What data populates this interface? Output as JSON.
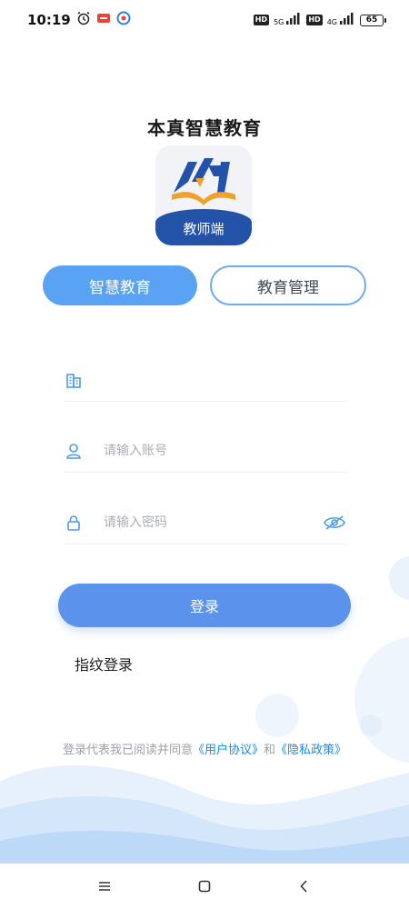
{
  "status_bar": {
    "time": "10:19",
    "net_1": "5G",
    "net_2": "4G",
    "hd": "HD",
    "battery": "65"
  },
  "app": {
    "title": "本真智慧教育",
    "logo_band_text": "教师端"
  },
  "tabs": [
    {
      "label": "智慧教育",
      "active": true
    },
    {
      "label": "教育管理",
      "active": false
    }
  ],
  "form": {
    "school_field": {
      "value": "",
      "placeholder": ""
    },
    "account_field": {
      "value": "",
      "placeholder": "请输入账号"
    },
    "password_field": {
      "value": "",
      "placeholder": "请输入密码"
    }
  },
  "login_button": "登录",
  "fingerprint_login": "指纹登录",
  "agreement": {
    "prefix": "登录代表我已阅读并同意",
    "user_agreement": "《用户协议》",
    "and": "和",
    "privacy_policy": "《隐私政策》"
  },
  "colors": {
    "primary": "#5a92ec",
    "tab_active": "#5aa2f4",
    "tab_border": "#6eaaf0",
    "link": "#1b8be0",
    "icon": "#4a9be8",
    "logo_band": "#2353a8",
    "logo_orange": "#f0a02c"
  },
  "icons": {
    "school": "building-icon",
    "account": "user-icon",
    "password": "lock-icon",
    "visibility": "eye-off-icon",
    "nav_menu": "menu-icon",
    "nav_home": "square-home-icon",
    "nav_back": "back-chevron-icon"
  }
}
